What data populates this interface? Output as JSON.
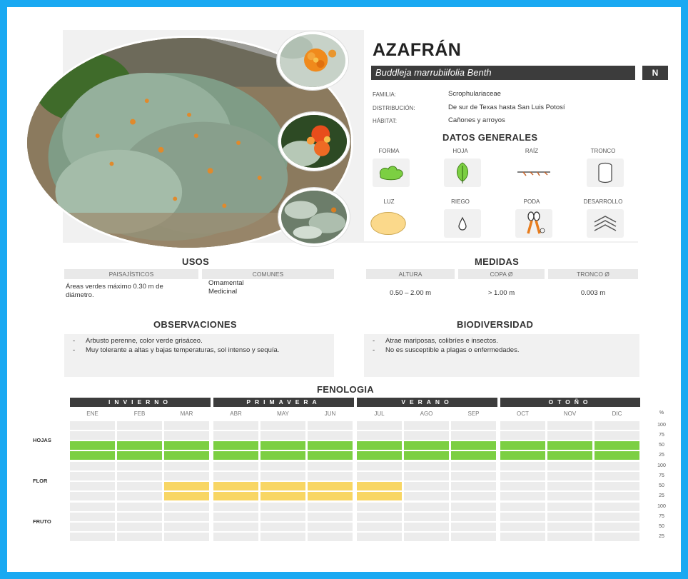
{
  "header": {
    "title": "AZAFRÁN",
    "scientific_name": "Buddleja marrubiifolia Benth",
    "badge": "N"
  },
  "info": [
    {
      "label": "FAMILIA:",
      "value": "Scrophulariaceae"
    },
    {
      "label": "DISTRIBUCIÓN:",
      "value": "De sur de Texas hasta San Luis Potosí"
    },
    {
      "label": "HÁBITAT:",
      "value": "Cañones y arroyos"
    }
  ],
  "datos_generales": {
    "title": "DATOS GENERALES",
    "items": [
      {
        "label": "FORMA",
        "icon": "shrub-shape-icon"
      },
      {
        "label": "HOJA",
        "icon": "leaf-icon"
      },
      {
        "label": "RAÍZ",
        "icon": "root-icon"
      },
      {
        "label": "TRONCO",
        "icon": "trunk-icon"
      },
      {
        "label": "LUZ",
        "icon": "sun-icon"
      },
      {
        "label": "RIEGO",
        "icon": "water-drop-icon"
      },
      {
        "label": "PODA",
        "icon": "pruning-shears-icon"
      },
      {
        "label": "DESARROLLO",
        "icon": "growth-chevrons-icon"
      }
    ]
  },
  "usos": {
    "title": "USOS",
    "paisajisticos_label": "PAISAJÍSTICOS",
    "comunes_label": "COMUNES",
    "paisajisticos_text": "Áreas verdes máximo 0.30 m de diámetro.",
    "comunes_text_1": "Ornamental",
    "comunes_text_2": "Medicinal"
  },
  "medidas": {
    "title": "MEDIDAS",
    "altura_label": "ALTURA",
    "copa_label": "COPA Ø",
    "tronco_label": "TRONCO Ø",
    "altura": "0.50 – 2.00 m",
    "copa": "> 1.00 m",
    "tronco": "0.003 m"
  },
  "observaciones": {
    "title": "OBSERVACIONES",
    "items": [
      "Arbusto perenne, color verde grisáceo.",
      "Muy tolerante a altas y bajas temperaturas, sol intenso y sequía."
    ]
  },
  "biodiversidad": {
    "title": "BIODIVERSIDAD",
    "items": [
      "Atrae mariposas, colibríes e insectos.",
      "No es susceptible a plagas o enfermedades."
    ]
  },
  "fenologia": {
    "title": "FENOLOGIA",
    "seasons": [
      "INVIERNO",
      "PRIMAVERA",
      "VERANO",
      "OTOÑO"
    ],
    "months": [
      "ENE",
      "FEB",
      "MAR",
      "ABR",
      "MAY",
      "JUN",
      "JUL",
      "AGO",
      "SEP",
      "OCT",
      "NOV",
      "DIC"
    ],
    "pct_header": "%",
    "pct_levels": [
      "100",
      "75",
      "50",
      "25"
    ],
    "rows": [
      {
        "label": "HOJAS",
        "color": "#7ccf42",
        "filled_levels": [
          "50",
          "25"
        ],
        "months": [
          "ENE",
          "FEB",
          "MAR",
          "ABR",
          "MAY",
          "JUN",
          "JUL",
          "AGO",
          "SEP",
          "OCT",
          "NOV",
          "DIC"
        ]
      },
      {
        "label": "FLOR",
        "color": "#f8d664",
        "filled_levels": [
          "50",
          "25"
        ],
        "months": [
          "MAR",
          "ABR",
          "MAY",
          "JUN",
          "JUL"
        ]
      },
      {
        "label": "FRUTO",
        "color": "#ececec",
        "filled_levels": [],
        "months": []
      }
    ]
  }
}
